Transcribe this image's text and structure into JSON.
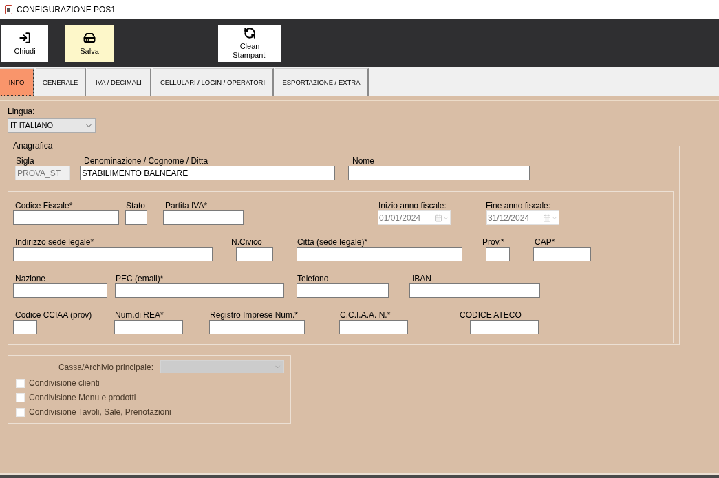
{
  "window": {
    "title": "CONFIGURAZIONE POS1"
  },
  "toolbar": [
    {
      "label": "Chiudi",
      "kind": "exit",
      "highlighted": false
    },
    {
      "label": "Salva",
      "kind": "save",
      "highlighted": true
    },
    {
      "label": "Clean Stampanti",
      "kind": "refresh",
      "highlighted": false
    }
  ],
  "tabs": [
    {
      "label": "INFO",
      "selected": true
    },
    {
      "label": "GENERALE",
      "selected": false
    },
    {
      "label": "IVA / DECIMALI",
      "selected": false
    },
    {
      "label": "CELLULARI / LOGIN / OPERATORI",
      "selected": false
    },
    {
      "label": "ESPORTAZIONE / EXTRA",
      "selected": false
    }
  ],
  "language": {
    "label": "Lingua:",
    "value": "IT ITALIANO"
  },
  "anagrafica": {
    "title": "Anagrafica",
    "fields": [
      {
        "label": "Sigla",
        "value": "PROVA_ST",
        "disabled": true
      },
      {
        "label": "Denominazione / Cognome / Ditta",
        "value": "STABILIMENTO BALNEARE",
        "disabled": false
      },
      {
        "label": "Nome",
        "disabled": false
      }
    ]
  },
  "details": {
    "fields": [
      {
        "label": "Codice Fiscale*",
        "kind": "text",
        "disabled": false
      },
      {
        "label": "Stato",
        "kind": "text",
        "disabled": false
      },
      {
        "label": "Partita IVA*",
        "kind": "text",
        "disabled": false
      },
      {
        "label": "Inizio anno fiscale:",
        "value": "01/01/2024",
        "kind": "date",
        "disabled": true
      },
      {
        "label": "Fine anno fiscale:",
        "value": "31/12/2024",
        "kind": "date",
        "disabled": true
      },
      {
        "label": "Indirizzo sede legale*",
        "kind": "text",
        "disabled": false
      },
      {
        "label": "N.Civico",
        "kind": "text",
        "disabled": false
      },
      {
        "label": "Città  (sede legale)*",
        "kind": "text",
        "disabled": false
      },
      {
        "label": "Prov.*",
        "kind": "text",
        "disabled": false
      },
      {
        "label": "CAP*",
        "kind": "text",
        "disabled": false
      },
      {
        "label": "Nazione",
        "kind": "text",
        "disabled": false
      },
      {
        "label": "PEC (email)*",
        "kind": "text",
        "disabled": false
      },
      {
        "label": "Telefono",
        "kind": "text",
        "disabled": false
      },
      {
        "label": "IBAN",
        "kind": "text",
        "disabled": false
      },
      {
        "label": "Codice CCIAA (prov)",
        "kind": "text",
        "disabled": false
      },
      {
        "label": "Num.di REA*",
        "kind": "text",
        "disabled": false
      },
      {
        "label": "Registro Imprese Num.*",
        "kind": "text",
        "disabled": false
      },
      {
        "label": "C.C.I.A.A. N.*",
        "kind": "text",
        "disabled": false
      },
      {
        "label": "CODICE ATECO",
        "kind": "text",
        "disabled": false
      }
    ]
  },
  "sharing": {
    "archive": {
      "label": "Cassa/Archivio principale:",
      "disabled": true
    },
    "options": [
      {
        "label": "Condivisione clienti",
        "checked": false
      },
      {
        "label": "Condivisione Menu e prodotti",
        "checked": false
      },
      {
        "label": "Condivisione Tavoli, Sale, Prenotazioni",
        "checked": false
      }
    ]
  }
}
